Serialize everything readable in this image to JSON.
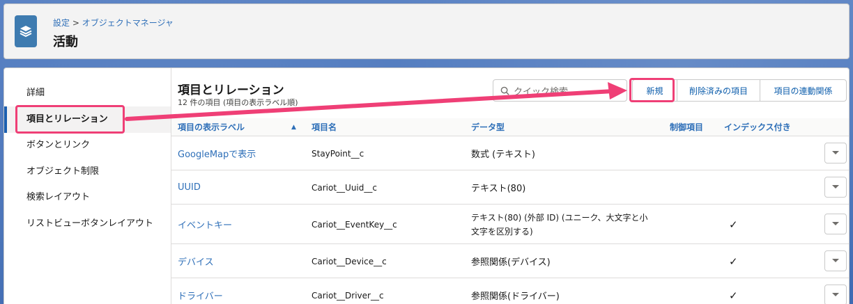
{
  "header": {
    "breadcrumb_setup": "設定",
    "breadcrumb_sep": ">",
    "breadcrumb_object_manager": "オブジェクトマネージャ",
    "title": "活動",
    "icon": "layers-icon"
  },
  "sidebar": {
    "items": [
      {
        "label": "詳細"
      },
      {
        "label": "項目とリレーション"
      },
      {
        "label": "ボタンとリンク"
      },
      {
        "label": "オブジェクト制限"
      },
      {
        "label": "検索レイアウト"
      },
      {
        "label": "リストビューボタンレイアウト"
      }
    ],
    "active_index": 1
  },
  "section": {
    "title": "項目とリレーション",
    "subtitle": "12 件の項目 (項目の表示ラベル順)"
  },
  "search": {
    "placeholder": "クイック検索",
    "icon": "search-icon"
  },
  "buttons": {
    "new": "新規",
    "deleted_fields": "削除済みの項目",
    "field_dependencies": "項目の連動関係"
  },
  "table": {
    "columns": {
      "label": "項目の表示ラベル",
      "sort_indicator": "▲",
      "api_name": "項目名",
      "data_type": "データ型",
      "controlling": "制御項目",
      "indexed": "インデックス付き"
    },
    "rows": [
      {
        "label": "GoogleMapで表示",
        "api_name": "StayPoint__c",
        "data_type": "数式 (テキスト)",
        "data_type_line2": "",
        "controlling": "",
        "indexed": ""
      },
      {
        "label": "UUID",
        "api_name": "Cariot__Uuid__c",
        "data_type": "テキスト(80)",
        "data_type_line2": "",
        "controlling": "",
        "indexed": ""
      },
      {
        "label": "イベントキー",
        "api_name": "Cariot__EventKey__c",
        "data_type": "テキスト(80) (外部 ID) (ユニーク、大文字と小",
        "data_type_line2": "文字を区別する)",
        "controlling": "",
        "indexed": "✓"
      },
      {
        "label": "デバイス",
        "api_name": "Cariot__Device__c",
        "data_type": "参照関係(デバイス)",
        "data_type_line2": "",
        "controlling": "",
        "indexed": "✓"
      },
      {
        "label": "ドライバー",
        "api_name": "Cariot__Driver__c",
        "data_type": "参照関係(ドライバー)",
        "data_type_line2": "",
        "controlling": "",
        "indexed": "✓"
      }
    ]
  },
  "colors": {
    "link": "#2e6fb8",
    "brand_icon": "#3e7bb0",
    "annotation": "#ef3f76",
    "active_border": "#1b5fb0"
  }
}
